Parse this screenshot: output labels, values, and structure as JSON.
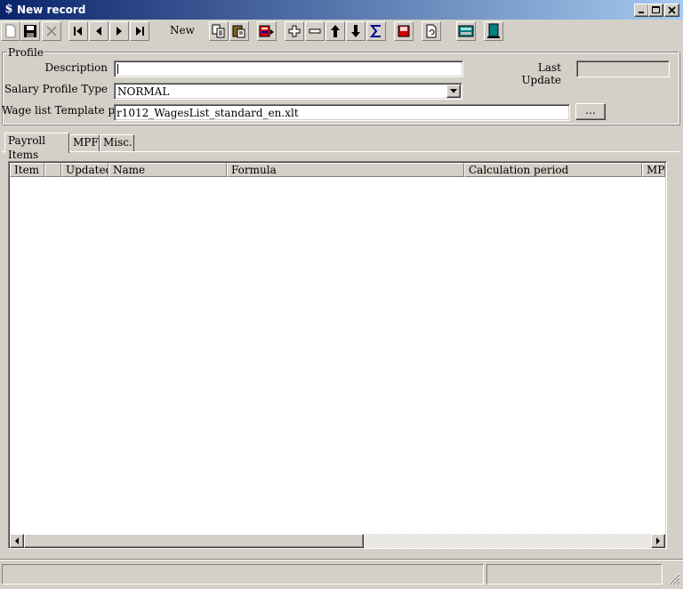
{
  "window": {
    "title": "New record",
    "icon": "app-dollar-icon",
    "controls": [
      "minimize-icon",
      "maximize-icon",
      "close-icon"
    ]
  },
  "toolbar": {
    "mode_label": "New",
    "buttons": [
      "new-doc-icon",
      "save-icon",
      "cancel-icon",
      "first-record-icon",
      "prev-record-icon",
      "next-record-icon",
      "last-record-icon",
      "copy-icon",
      "paste-icon",
      "copy-record-icon",
      "add-icon",
      "remove-icon",
      "move-up-icon",
      "move-down-icon",
      "sum-icon",
      "book-icon",
      "refresh-page-icon",
      "calculator-icon",
      "exit-door-icon"
    ]
  },
  "profile": {
    "group_label": "Profile",
    "description_label": "Description",
    "description_value": "",
    "last_update_label": "Last Update",
    "last_update_value": "",
    "salary_type_label": "Salary Profile Type",
    "salary_type_value": "NORMAL",
    "template_label": "Wage list Template path",
    "template_value": "r1012_WagesList_standard_en.xlt",
    "browse_label": "..."
  },
  "tabs": [
    {
      "label": "Payroll Items",
      "active": true
    },
    {
      "label": "MPF",
      "active": false
    },
    {
      "label": "Misc.",
      "active": false
    }
  ],
  "grid": {
    "columns": [
      "Item",
      "",
      "Updated",
      "Name",
      "Formula",
      "Calculation period",
      "MPF"
    ],
    "rows": []
  },
  "statusbar": {
    "panel1": "",
    "panel2": ""
  }
}
